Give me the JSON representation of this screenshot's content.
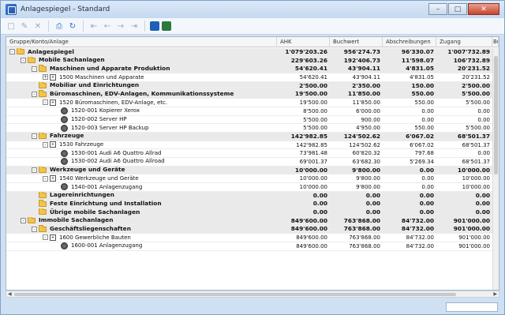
{
  "window": {
    "title": "Anlagespiegel - Standard"
  },
  "columns": [
    "Gruppe/Konto/Anlage",
    "AHK",
    "Buchwert",
    "Abschreibungen",
    "Zugang",
    "Bu"
  ],
  "rows": [
    {
      "type": "b",
      "icon": "folder",
      "exp": "-",
      "indent": 0,
      "name": "Anlagespiegel",
      "ahk": "1'079'203.26",
      "bw": "956'274.73",
      "ab": "96'330.07",
      "zu": "1'007'732.89"
    },
    {
      "type": "b",
      "icon": "folder",
      "exp": "-",
      "indent": 1,
      "name": "Mobile Sachanlagen",
      "ahk": "229'603.26",
      "bw": "192'406.73",
      "ab": "11'598.07",
      "zu": "106'732.89"
    },
    {
      "type": "b",
      "icon": "folder",
      "exp": "-",
      "indent": 2,
      "name": "Maschinen und Apparate Produktion",
      "ahk": "54'620.41",
      "bw": "43'904.11",
      "ab": "4'831.05",
      "zu": "20'231.52"
    },
    {
      "type": "d",
      "icon": "konto",
      "exp": "+",
      "indent": 3,
      "name": "1500 Maschinen und Apparate",
      "ahk": "54'620.41",
      "bw": "43'904.11",
      "ab": "4'831.05",
      "zu": "20'231.52"
    },
    {
      "type": "b",
      "icon": "folder",
      "exp": "",
      "indent": 2,
      "name": "Mobiliar und Einrichtungen",
      "ahk": "2'500.00",
      "bw": "2'350.00",
      "ab": "150.00",
      "zu": "2'500.00"
    },
    {
      "type": "b",
      "icon": "folder",
      "exp": "-",
      "indent": 2,
      "name": "Büromaschinen, EDV-Anlagen, Kommunikationssysteme",
      "ahk": "19'500.00",
      "bw": "11'850.00",
      "ab": "550.00",
      "zu": "5'500.00"
    },
    {
      "type": "d",
      "icon": "konto",
      "exp": "-",
      "indent": 3,
      "name": "1520 Büromaschinen, EDV-Anlage, etc.",
      "ahk": "19'500.00",
      "bw": "11'850.00",
      "ab": "550.00",
      "zu": "5'500.00"
    },
    {
      "type": "d",
      "icon": "asset",
      "exp": "",
      "indent": 4,
      "name": "1520-001 Kopierer Xerox",
      "ahk": "8'500.00",
      "bw": "6'000.00",
      "ab": "0.00",
      "zu": "0.00"
    },
    {
      "type": "d",
      "icon": "asset",
      "exp": "",
      "indent": 4,
      "name": "1520-002 Server HP",
      "ahk": "5'500.00",
      "bw": "900.00",
      "ab": "0.00",
      "zu": "0.00"
    },
    {
      "type": "d",
      "icon": "asset",
      "exp": "",
      "indent": 4,
      "name": "1520-003 Server HP Backup",
      "ahk": "5'500.00",
      "bw": "4'950.00",
      "ab": "550.00",
      "zu": "5'500.00"
    },
    {
      "type": "b",
      "icon": "folder",
      "exp": "-",
      "indent": 2,
      "name": "Fahrzeuge",
      "ahk": "142'982.85",
      "bw": "124'502.62",
      "ab": "6'067.02",
      "zu": "68'501.37"
    },
    {
      "type": "d",
      "icon": "konto",
      "exp": "-",
      "indent": 3,
      "name": "1530 Fahrzeuge",
      "ahk": "142'982.85",
      "bw": "124'502.62",
      "ab": "6'067.02",
      "zu": "68'501.37"
    },
    {
      "type": "d",
      "icon": "asset",
      "exp": "",
      "indent": 4,
      "name": "1530-001 Audi A6 Quattro Allrad",
      "ahk": "73'981.48",
      "bw": "60'820.32",
      "ab": "797.68",
      "zu": "0.00"
    },
    {
      "type": "d",
      "icon": "asset",
      "exp": "",
      "indent": 4,
      "name": "1530-002 Audi A6 Quattro Allroad",
      "ahk": "69'001.37",
      "bw": "63'682.30",
      "ab": "5'269.34",
      "zu": "68'501.37"
    },
    {
      "type": "b",
      "icon": "folder",
      "exp": "-",
      "indent": 2,
      "name": "Werkzeuge und Geräte",
      "ahk": "10'000.00",
      "bw": "9'800.00",
      "ab": "0.00",
      "zu": "10'000.00"
    },
    {
      "type": "d",
      "icon": "konto",
      "exp": "-",
      "indent": 3,
      "name": "1540 Werkzeuge und Geräte",
      "ahk": "10'000.00",
      "bw": "9'800.00",
      "ab": "0.00",
      "zu": "10'000.00"
    },
    {
      "type": "d",
      "icon": "asset",
      "exp": "",
      "indent": 4,
      "name": "1540-001 Anlagenzugang",
      "ahk": "10'000.00",
      "bw": "9'800.00",
      "ab": "0.00",
      "zu": "10'000.00"
    },
    {
      "type": "b",
      "icon": "folder",
      "exp": "",
      "indent": 2,
      "name": "Lagereinrichtungen",
      "ahk": "0.00",
      "bw": "0.00",
      "ab": "0.00",
      "zu": "0.00"
    },
    {
      "type": "b",
      "icon": "folder",
      "exp": "",
      "indent": 2,
      "name": "Feste Einrichtung und Installation",
      "ahk": "0.00",
      "bw": "0.00",
      "ab": "0.00",
      "zu": "0.00"
    },
    {
      "type": "b",
      "icon": "folder",
      "exp": "",
      "indent": 2,
      "name": "Übrige mobile Sachanlagen",
      "ahk": "0.00",
      "bw": "0.00",
      "ab": "0.00",
      "zu": "0.00"
    },
    {
      "type": "b",
      "icon": "folder",
      "exp": "-",
      "indent": 1,
      "name": "Immobile Sachanlagen",
      "ahk": "849'600.00",
      "bw": "763'868.00",
      "ab": "84'732.00",
      "zu": "901'000.00"
    },
    {
      "type": "b",
      "icon": "folder",
      "exp": "-",
      "indent": 2,
      "name": "Geschäftsliegenschaften",
      "ahk": "849'600.00",
      "bw": "763'868.00",
      "ab": "84'732.00",
      "zu": "901'000.00"
    },
    {
      "type": "d",
      "icon": "konto",
      "exp": "-",
      "indent": 3,
      "name": "1600 Gewerbliche Bauten",
      "ahk": "849'600.00",
      "bw": "763'868.00",
      "ab": "84'732.00",
      "zu": "901'000.00"
    },
    {
      "type": "d",
      "icon": "asset",
      "exp": "",
      "indent": 4,
      "name": "1600-001 Anlagenzugang",
      "ahk": "849'600.00",
      "bw": "763'868.00",
      "ab": "84'732.00",
      "zu": "901'000.00"
    }
  ]
}
